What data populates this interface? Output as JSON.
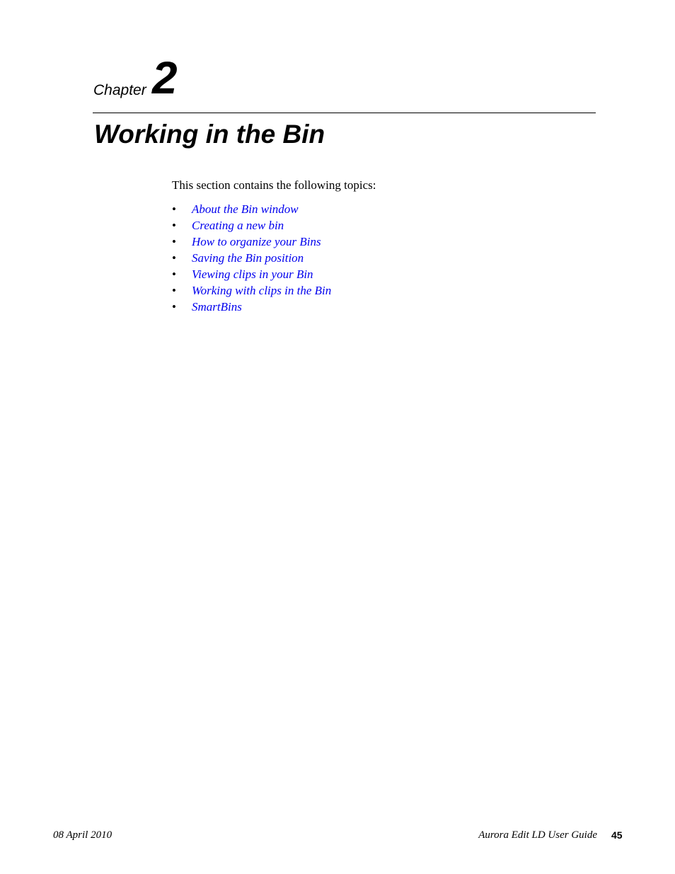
{
  "chapter": {
    "label": "Chapter",
    "number": "2"
  },
  "title": "Working in the Bin",
  "intro": "This section contains the following topics:",
  "bullet_glyph": "•",
  "topics": [
    {
      "label": "About the Bin window"
    },
    {
      "label": "Creating a new bin"
    },
    {
      "label": "How to organize your Bins"
    },
    {
      "label": "Saving the Bin position"
    },
    {
      "label": "Viewing clips in your Bin"
    },
    {
      "label": "Working with clips in the Bin"
    },
    {
      "label": "SmartBins"
    }
  ],
  "colors": {
    "link": "#0000ee",
    "text": "#000000"
  },
  "footer": {
    "date": "08 April 2010",
    "guide": "Aurora Edit LD User Guide",
    "page": "45"
  }
}
